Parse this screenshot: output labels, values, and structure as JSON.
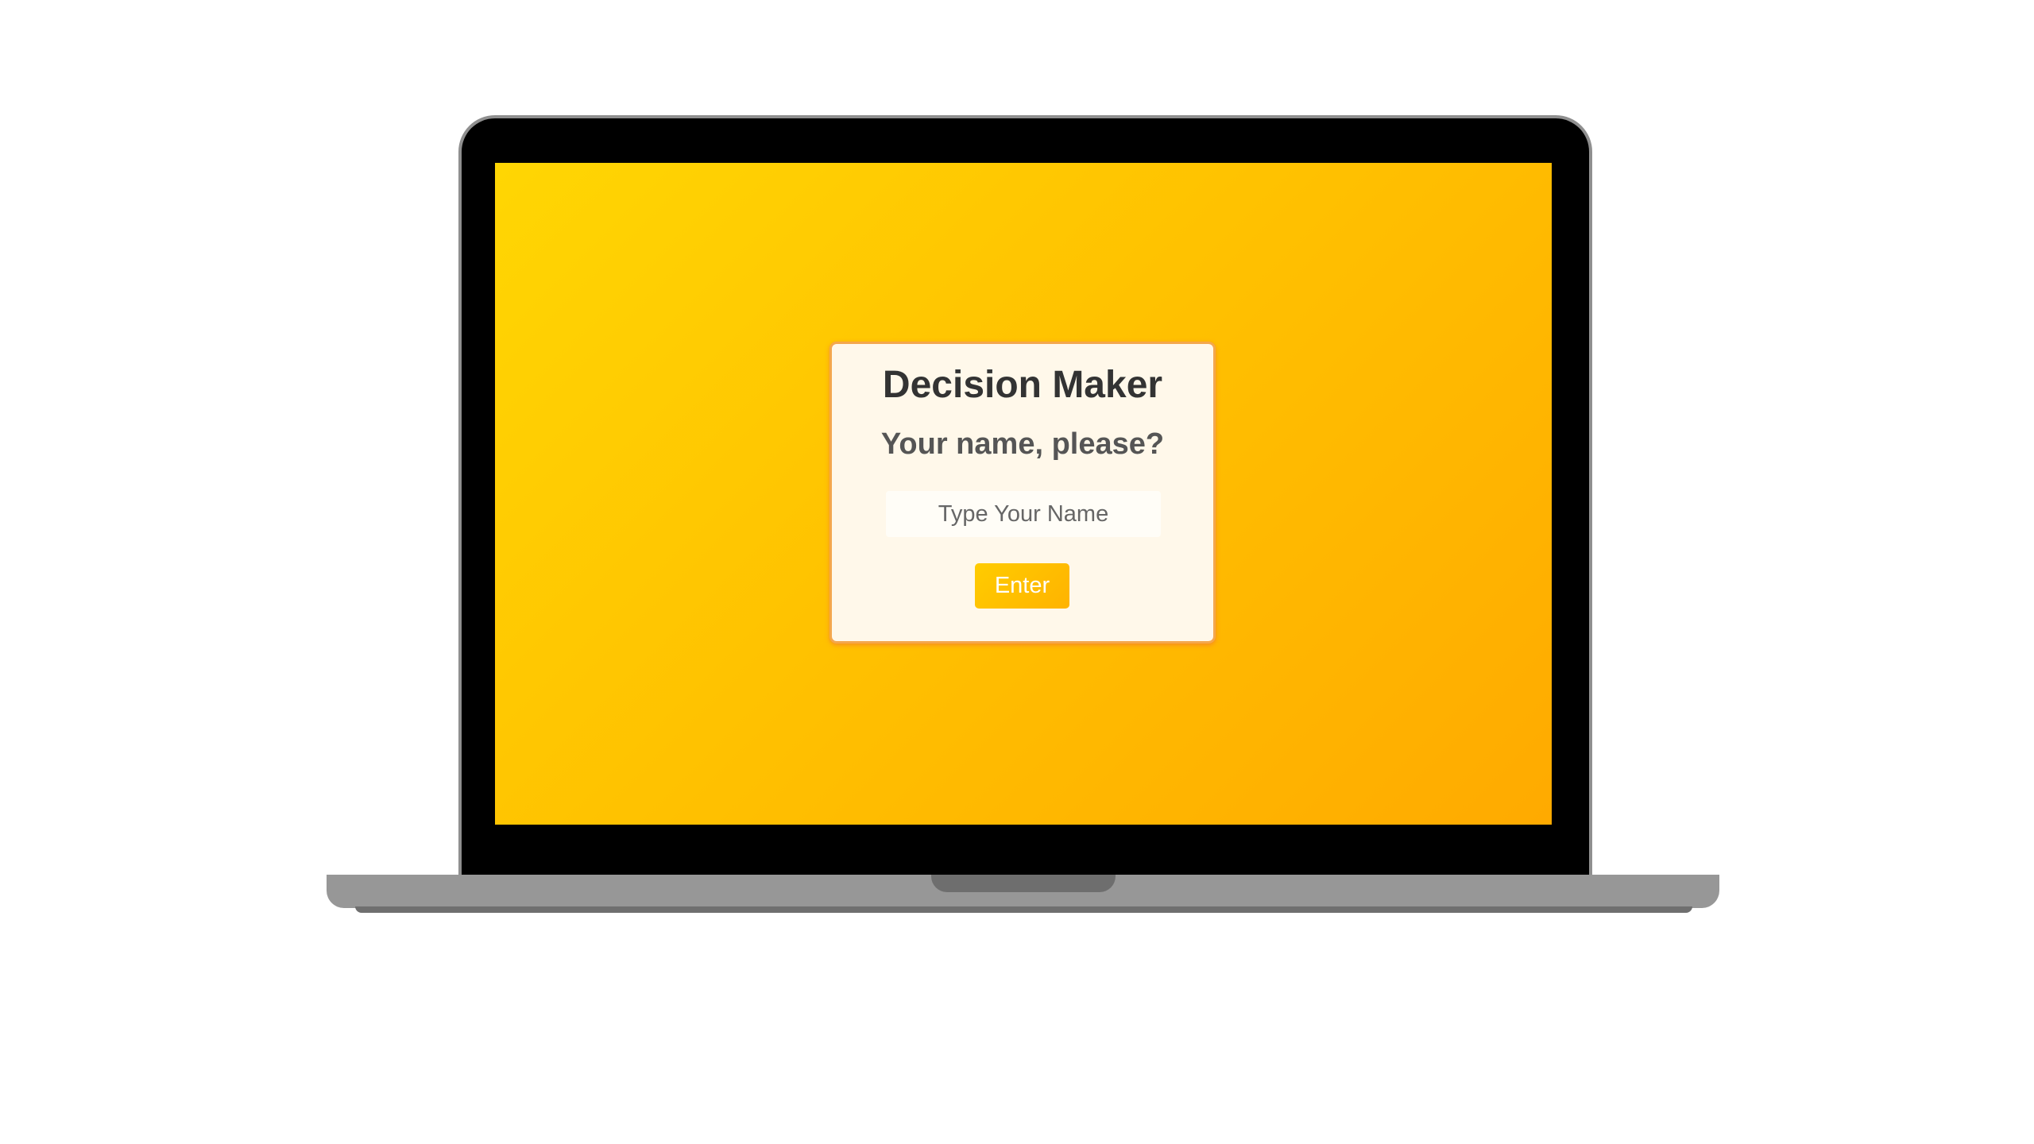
{
  "app": {
    "title": "Decision Maker",
    "prompt": "Your name, please?"
  },
  "form": {
    "name_placeholder": "Type Your Name",
    "name_value": "",
    "enter_label": "Enter"
  },
  "colors": {
    "screen_gradient_start": "#ffd603",
    "screen_gradient_end": "#ffaa00",
    "card_background": "#fff8ea",
    "card_border": "#f4a74d",
    "button_background": "#ffbf00",
    "button_text": "#ffffff",
    "laptop_bezel": "#000000",
    "laptop_body": "#979797"
  }
}
